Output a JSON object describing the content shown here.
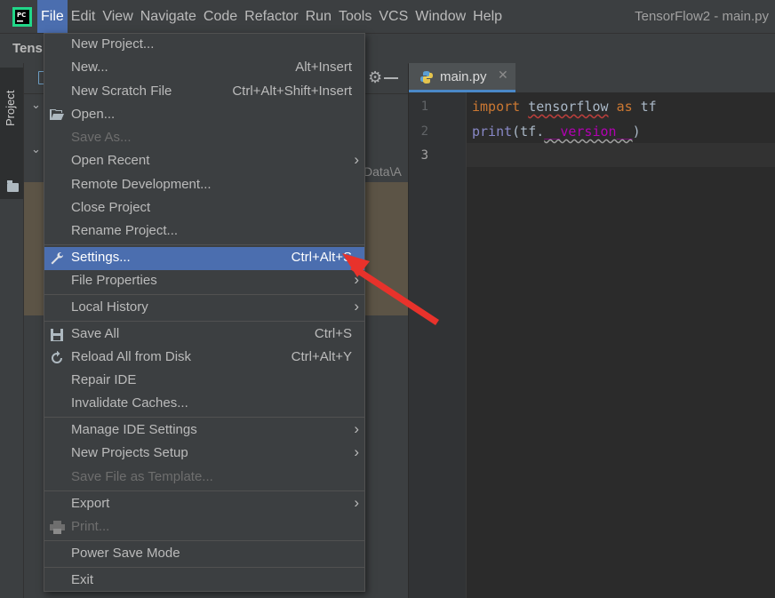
{
  "menubar": {
    "items": [
      {
        "label": "File"
      },
      {
        "label": "Edit"
      },
      {
        "label": "View"
      },
      {
        "label": "Navigate"
      },
      {
        "label": "Code"
      },
      {
        "label": "Refactor"
      },
      {
        "label": "Run"
      },
      {
        "label": "Tools"
      },
      {
        "label": "VCS"
      },
      {
        "label": "Window"
      },
      {
        "label": "Help"
      }
    ],
    "window_title": "TensorFlow2 - main.py"
  },
  "navbar": {
    "project_name": "Tens"
  },
  "tool_window": {
    "tab_label": "Project"
  },
  "project_panel": {
    "path_fragment": "Data\\A"
  },
  "editor": {
    "tab_label": "main.py",
    "line_numbers": [
      "1",
      "2",
      "3"
    ],
    "code": {
      "line1_kw": "import",
      "line1_module": "tensorflow",
      "line1_as": "as",
      "line1_alias": "tf",
      "line2_fn": "print",
      "line2_open": "(tf.",
      "line2_dunder": "__version__",
      "line2_close": ")"
    }
  },
  "file_menu": {
    "items": {
      "new_project": {
        "label": "New Project..."
      },
      "new": {
        "label": "New...",
        "shortcut": "Alt+Insert"
      },
      "new_scratch": {
        "label": "New Scratch File",
        "shortcut": "Ctrl+Alt+Shift+Insert"
      },
      "open": {
        "label": "Open..."
      },
      "save_as": {
        "label": "Save As..."
      },
      "open_recent": {
        "label": "Open Recent"
      },
      "remote_dev": {
        "label": "Remote Development..."
      },
      "close_project": {
        "label": "Close Project"
      },
      "rename_project": {
        "label": "Rename Project..."
      },
      "settings": {
        "label": "Settings...",
        "shortcut": "Ctrl+Alt+S"
      },
      "file_properties": {
        "label": "File Properties"
      },
      "local_history": {
        "label": "Local History"
      },
      "save_all": {
        "label": "Save All",
        "shortcut": "Ctrl+S"
      },
      "reload": {
        "label": "Reload All from Disk",
        "shortcut": "Ctrl+Alt+Y"
      },
      "repair_ide": {
        "label": "Repair IDE"
      },
      "invalidate_caches": {
        "label": "Invalidate Caches..."
      },
      "manage_ide_settings": {
        "label": "Manage IDE Settings"
      },
      "new_projects_setup": {
        "label": "New Projects Setup"
      },
      "save_template": {
        "label": "Save File as Template..."
      },
      "export": {
        "label": "Export"
      },
      "print": {
        "label": "Print..."
      },
      "power_save": {
        "label": "Power Save Mode"
      },
      "exit": {
        "label": "Exit"
      }
    }
  },
  "colors": {
    "menu_bg": "#3c3f41",
    "selection": "#4b6eaf",
    "annotation_arrow": "#e8322b"
  }
}
